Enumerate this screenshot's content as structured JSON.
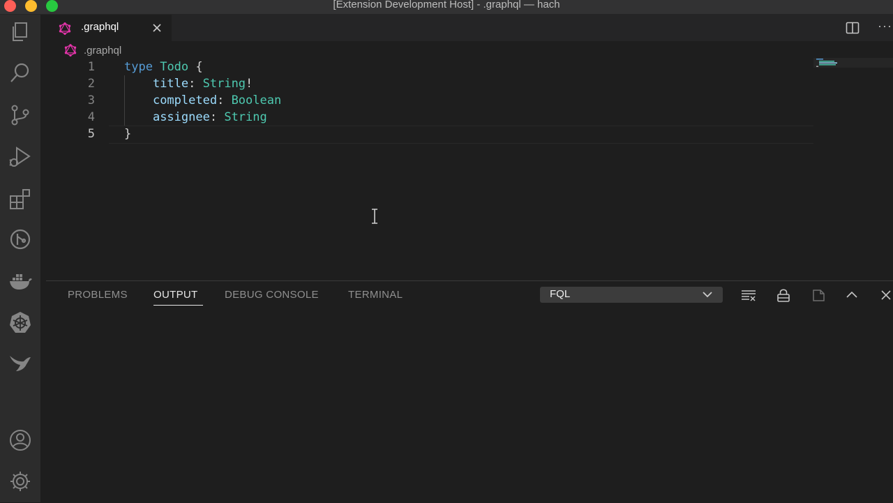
{
  "window": {
    "title": "[Extension Development Host] - .graphql — hach"
  },
  "activity_bar": {
    "items": [
      {
        "icon": "explorer-icon"
      },
      {
        "icon": "search-icon"
      },
      {
        "icon": "source-control-icon"
      },
      {
        "icon": "run-debug-icon"
      },
      {
        "icon": "extensions-icon"
      },
      {
        "icon": "gitlens-icon"
      },
      {
        "icon": "docker-icon"
      },
      {
        "icon": "kubernetes-icon"
      },
      {
        "icon": "bird-icon"
      },
      {
        "icon": "account-icon"
      },
      {
        "icon": "settings-gear-icon"
      }
    ]
  },
  "tabs": [
    {
      "label": ".graphql",
      "icon": "graphql-icon",
      "active": true
    }
  ],
  "breadcrumb": {
    "label": ".graphql"
  },
  "editor": {
    "lines": [
      {
        "number": "1",
        "tokens": [
          [
            "type",
            "kw"
          ],
          [
            " ",
            "punc"
          ],
          [
            "Todo",
            "ty"
          ],
          [
            " {",
            "punc"
          ]
        ]
      },
      {
        "number": "2",
        "tokens": [
          [
            "    ",
            "punc"
          ],
          [
            "title",
            "field"
          ],
          [
            ": ",
            "punc"
          ],
          [
            "String",
            "ty"
          ],
          [
            "!",
            "punc"
          ]
        ]
      },
      {
        "number": "3",
        "tokens": [
          [
            "    ",
            "punc"
          ],
          [
            "completed",
            "field"
          ],
          [
            ": ",
            "punc"
          ],
          [
            "Boolean",
            "ty"
          ]
        ]
      },
      {
        "number": "4",
        "tokens": [
          [
            "    ",
            "punc"
          ],
          [
            "assignee",
            "field"
          ],
          [
            ": ",
            "punc"
          ],
          [
            "String",
            "ty"
          ]
        ]
      },
      {
        "number": "5",
        "tokens": [
          [
            "}",
            "punc"
          ]
        ]
      }
    ],
    "active_line": "5"
  },
  "panel": {
    "tabs": [
      "PROBLEMS",
      "OUTPUT",
      "DEBUG CONSOLE",
      "TERMINAL"
    ],
    "active_tab": "OUTPUT",
    "output_channel": "FQL"
  },
  "colors": {
    "keyword": "#569cd6",
    "type": "#4ec9b0",
    "field": "#9cdcfe",
    "graphql_brand": "#e535ab"
  }
}
